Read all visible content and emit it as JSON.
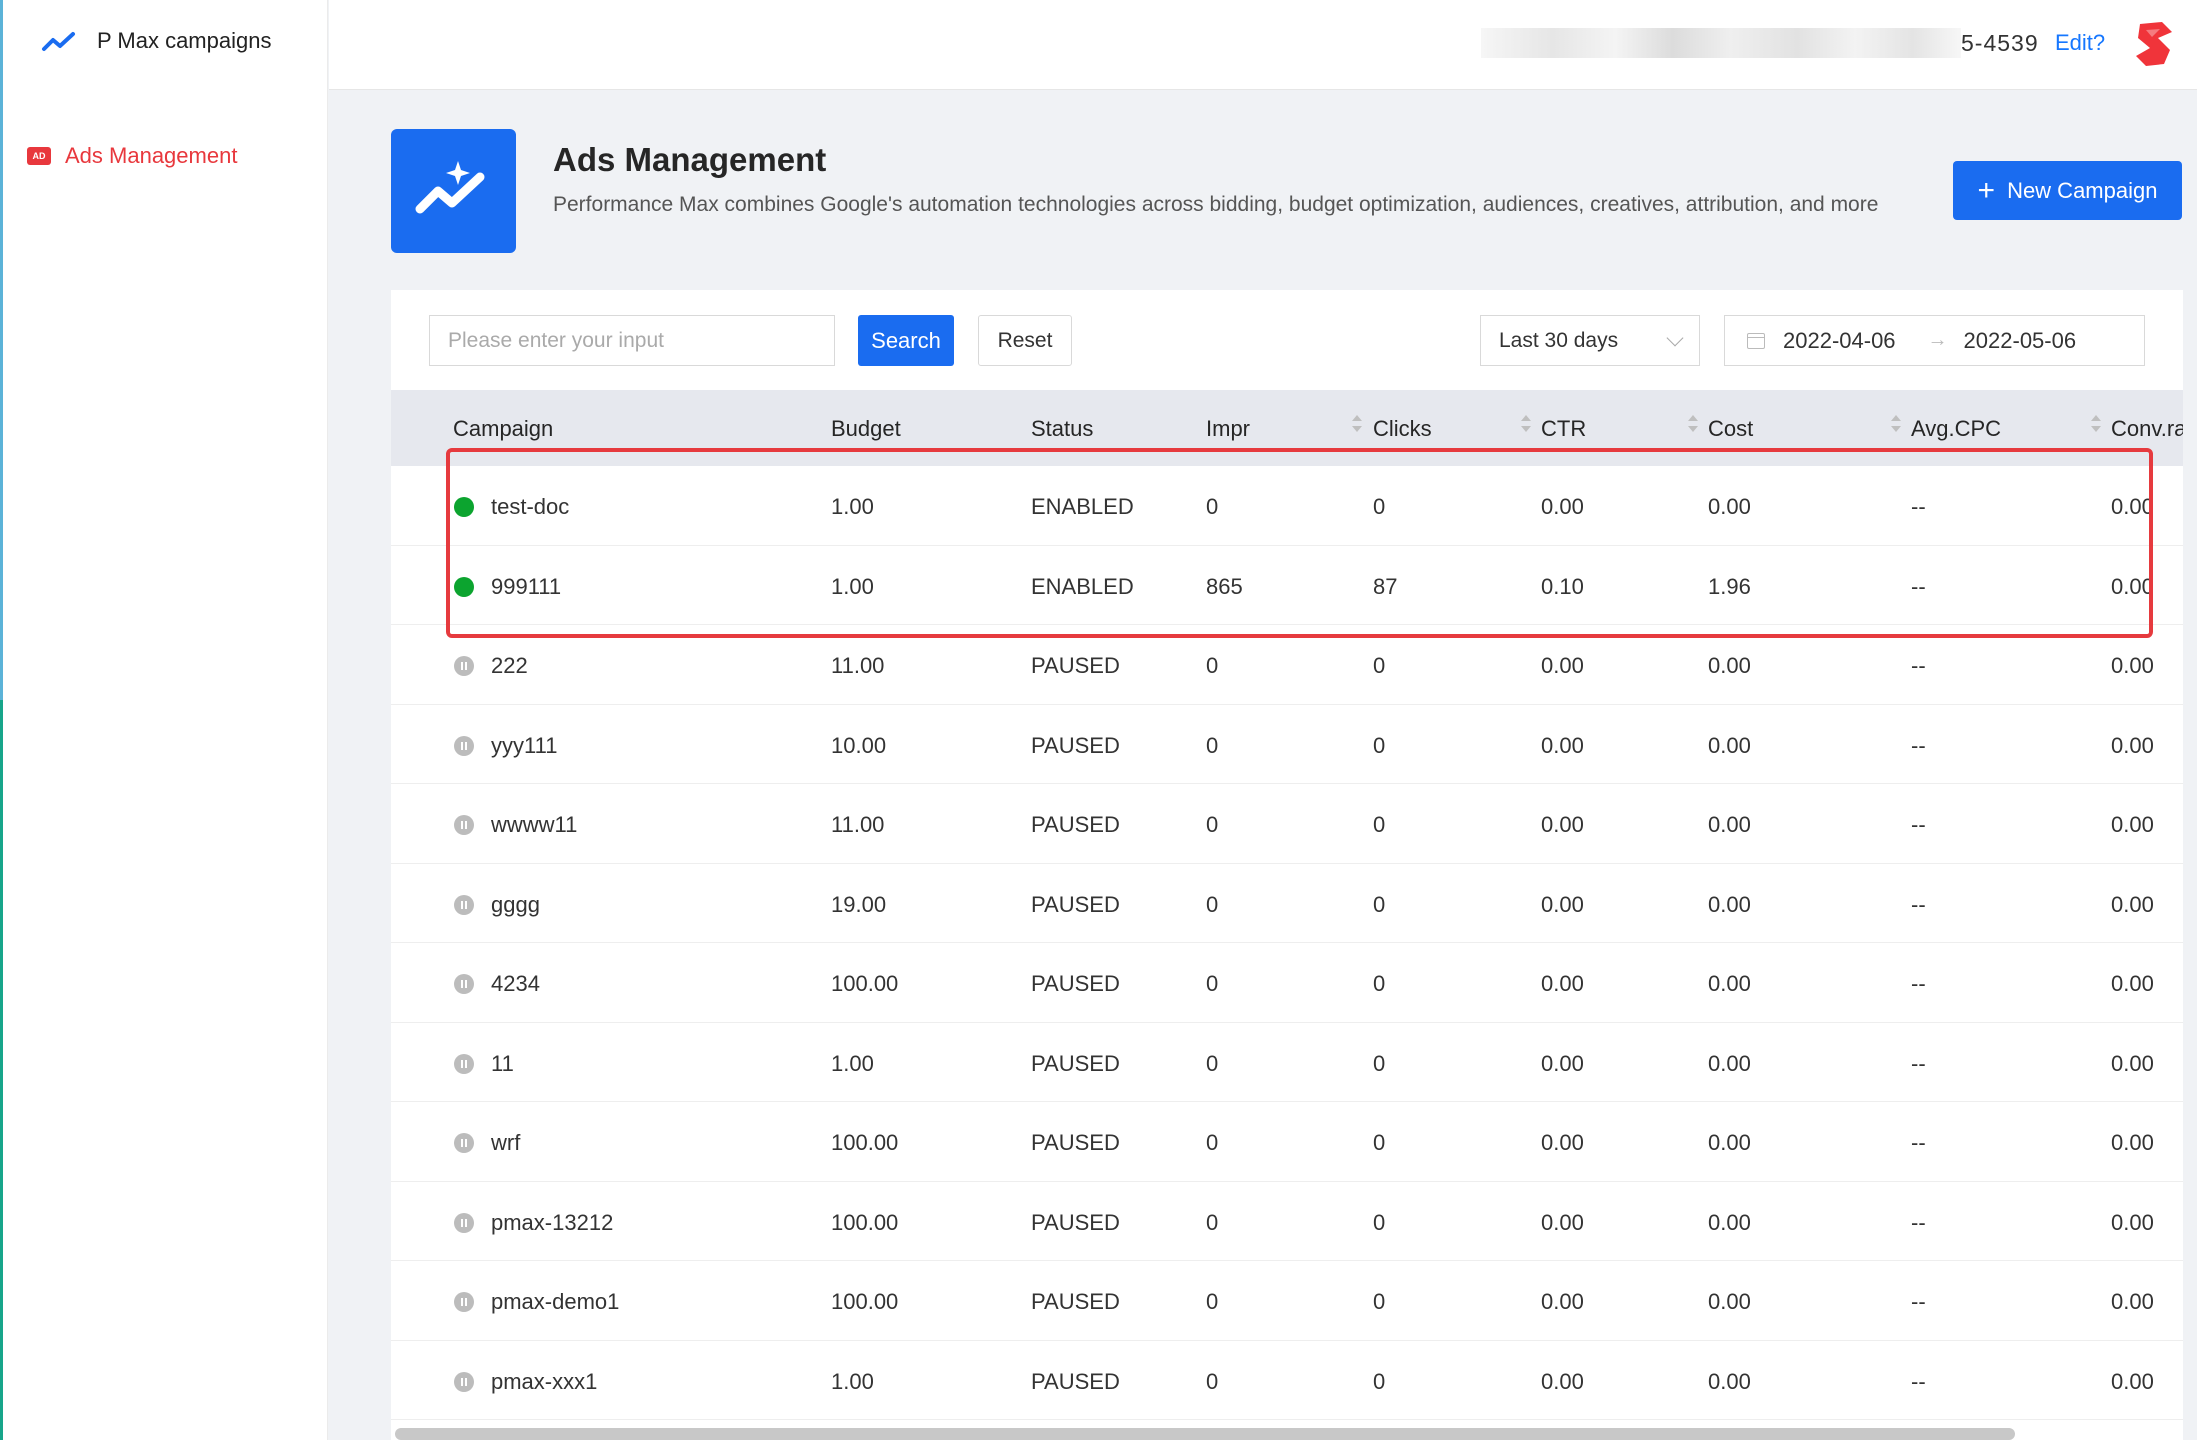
{
  "sidebar": {
    "brand_title": "P Max campaigns",
    "items": [
      {
        "label": "Ads Management",
        "icon": "ad-icon",
        "icon_text": "AD",
        "active": true
      }
    ]
  },
  "header": {
    "account_id": "5-4539",
    "edit_label": "Edit?"
  },
  "page": {
    "title": "Ads Management",
    "description": "Performance Max combines Google's automation technologies across bidding, budget optimization, audiences, creatives, attribution, and more",
    "new_campaign_label": "New Campaign"
  },
  "filters": {
    "search_placeholder": "Please enter your input",
    "search_label": "Search",
    "reset_label": "Reset",
    "range_value": "Last 30 days",
    "date_start": "2022-04-06",
    "date_end": "2022-05-06"
  },
  "table": {
    "columns": [
      "Campaign",
      "Budget",
      "Status",
      "Impr",
      "Clicks",
      "CTR",
      "Cost",
      "Avg.CPC",
      "Conv.ra"
    ],
    "rows": [
      {
        "campaign": "test-doc",
        "budget": "1.00",
        "status": "ENABLED",
        "impr": "0",
        "clicks": "0",
        "ctr": "0.00",
        "cost": "0.00",
        "avg_cpc": "--",
        "conv": "0.00"
      },
      {
        "campaign": "999111",
        "budget": "1.00",
        "status": "ENABLED",
        "impr": "865",
        "clicks": "87",
        "ctr": "0.10",
        "cost": "1.96",
        "avg_cpc": "--",
        "conv": "0.00"
      },
      {
        "campaign": "222",
        "budget": "11.00",
        "status": "PAUSED",
        "impr": "0",
        "clicks": "0",
        "ctr": "0.00",
        "cost": "0.00",
        "avg_cpc": "--",
        "conv": "0.00"
      },
      {
        "campaign": "yyy111",
        "budget": "10.00",
        "status": "PAUSED",
        "impr": "0",
        "clicks": "0",
        "ctr": "0.00",
        "cost": "0.00",
        "avg_cpc": "--",
        "conv": "0.00"
      },
      {
        "campaign": "wwww11",
        "budget": "11.00",
        "status": "PAUSED",
        "impr": "0",
        "clicks": "0",
        "ctr": "0.00",
        "cost": "0.00",
        "avg_cpc": "--",
        "conv": "0.00"
      },
      {
        "campaign": "gggg",
        "budget": "19.00",
        "status": "PAUSED",
        "impr": "0",
        "clicks": "0",
        "ctr": "0.00",
        "cost": "0.00",
        "avg_cpc": "--",
        "conv": "0.00"
      },
      {
        "campaign": "4234",
        "budget": "100.00",
        "status": "PAUSED",
        "impr": "0",
        "clicks": "0",
        "ctr": "0.00",
        "cost": "0.00",
        "avg_cpc": "--",
        "conv": "0.00"
      },
      {
        "campaign": "11",
        "budget": "1.00",
        "status": "PAUSED",
        "impr": "0",
        "clicks": "0",
        "ctr": "0.00",
        "cost": "0.00",
        "avg_cpc": "--",
        "conv": "0.00"
      },
      {
        "campaign": "wrf",
        "budget": "100.00",
        "status": "PAUSED",
        "impr": "0",
        "clicks": "0",
        "ctr": "0.00",
        "cost": "0.00",
        "avg_cpc": "--",
        "conv": "0.00"
      },
      {
        "campaign": "pmax-13212",
        "budget": "100.00",
        "status": "PAUSED",
        "impr": "0",
        "clicks": "0",
        "ctr": "0.00",
        "cost": "0.00",
        "avg_cpc": "--",
        "conv": "0.00"
      },
      {
        "campaign": "pmax-demo1",
        "budget": "100.00",
        "status": "PAUSED",
        "impr": "0",
        "clicks": "0",
        "ctr": "0.00",
        "cost": "0.00",
        "avg_cpc": "--",
        "conv": "0.00"
      },
      {
        "campaign": "pmax-xxx1",
        "budget": "1.00",
        "status": "PAUSED",
        "impr": "0",
        "clicks": "0",
        "ctr": "0.00",
        "cost": "0.00",
        "avg_cpc": "--",
        "conv": "0.00"
      }
    ]
  },
  "colors": {
    "primary": "#1a6cf0",
    "accent_red": "#e8383d",
    "enabled": "#0ca42f",
    "paused": "#bcbcbc",
    "highlight": "#e63a3e"
  }
}
